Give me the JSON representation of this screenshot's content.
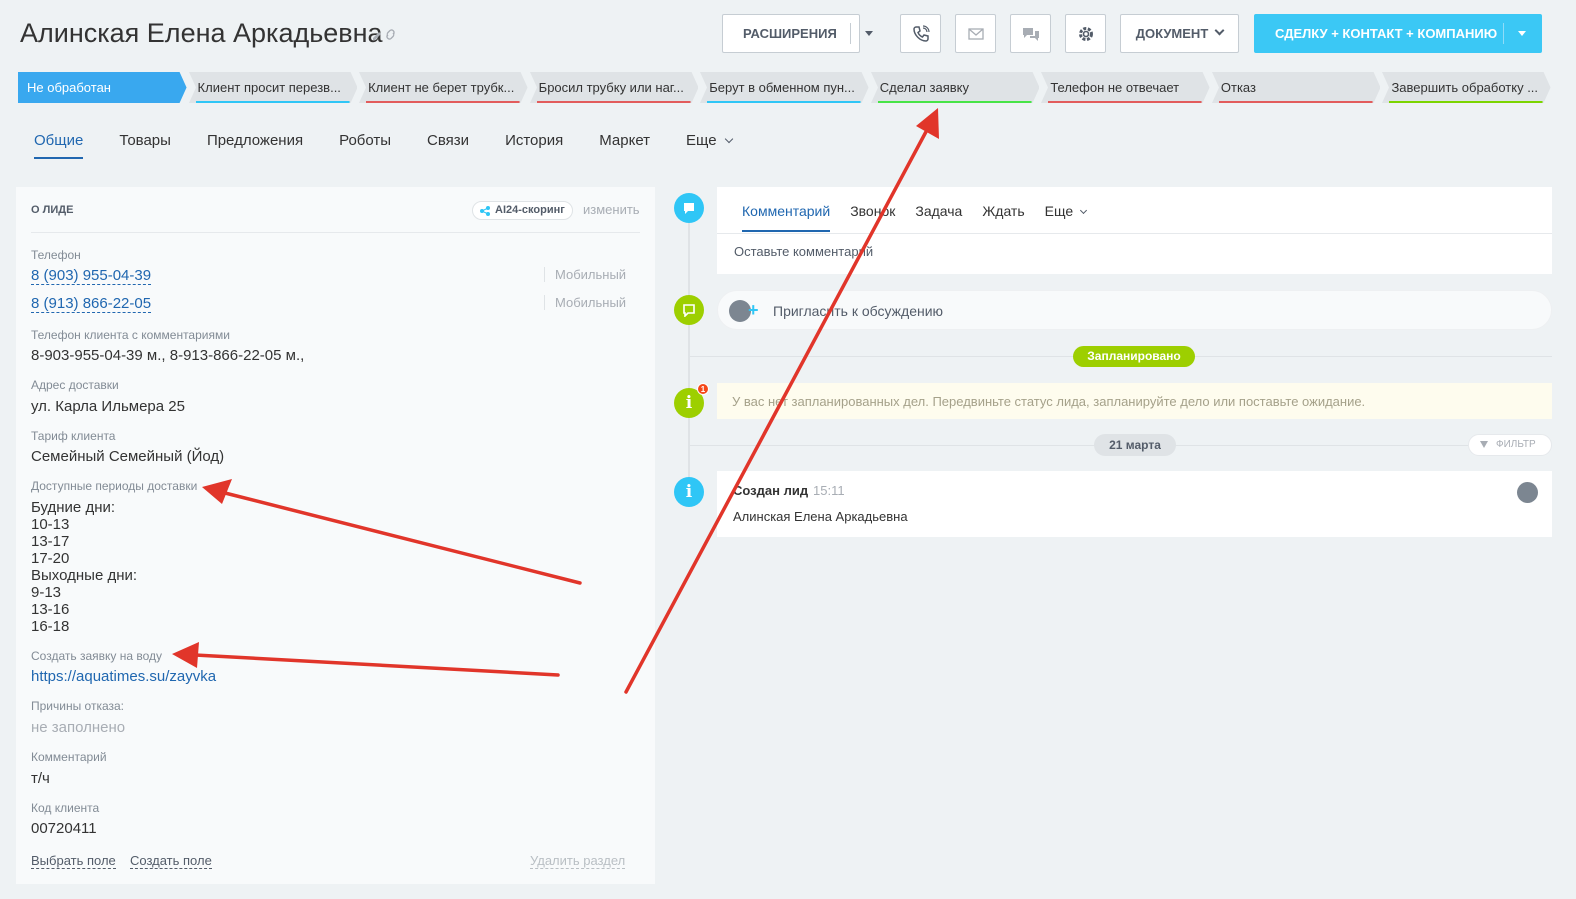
{
  "header": {
    "title": "Алинская Елена  Аркадьевна",
    "extensions_label": "РАСШИРЕНИЯ",
    "document_label": "ДОКУМЕНТ",
    "convert_label": "СДЕЛКУ + КОНТАКТ + КОМПАНИЮ"
  },
  "stages": [
    {
      "label": "Не обработан",
      "color": "#39a8ef",
      "active": true
    },
    {
      "label": "Клиент просит перезв...",
      "color": "#2fc6f6"
    },
    {
      "label": "Клиент не берет трубк...",
      "color": "#e25c5c"
    },
    {
      "label": "Бросил трубку или наг...",
      "color": "#e25c5c"
    },
    {
      "label": "Берут в обменном пун...",
      "color": "#2fc6f6"
    },
    {
      "label": "Сделал заявку",
      "color": "#47e447"
    },
    {
      "label": "Телефон не отвечает",
      "color": "#e25c5c"
    },
    {
      "label": "Отказ",
      "color": "#e25c5c"
    },
    {
      "label": "Завершить обработку ...",
      "color": "#7bd500"
    }
  ],
  "tabs": [
    "Общие",
    "Товары",
    "Предложения",
    "Роботы",
    "Связи",
    "История",
    "Маркет",
    "Еще"
  ],
  "about": {
    "heading": "О ЛИДЕ",
    "ai_badge": "AI24-скоринг",
    "change": "изменить",
    "phone_label": "Телефон",
    "phones": [
      {
        "number": "8 (903) 955-04-39",
        "type": "Мобильный"
      },
      {
        "number": "8 (913) 866-22-05",
        "type": "Мобильный"
      }
    ],
    "phone_comments_label": "Телефон клиента с комментариями",
    "phone_comments_value": "8-903-955-04-39 м., 8-913-866-22-05 м.,",
    "address_label": "Адрес доставки",
    "address_value": "ул. Карла Ильмера 25",
    "tariff_label": "Тариф клиента",
    "tariff_value": "Семейный Семейный (Йод)",
    "periods_label": "Доступные периоды доставки",
    "periods_value": "Будние дни:\n10-13\n13-17\n17-20\nВыходные дни:\n9-13\n13-16\n16-18",
    "order_label": "Создать заявку на воду",
    "order_value": "https://aquatimes.su/zayvka",
    "reasons_label": "Причины отказа:",
    "reasons_value": "не заполнено",
    "comment_label": "Комментарий",
    "comment_value": "т/ч",
    "code_label": "Код клиента",
    "code_value": "00720411",
    "select_field": "Выбрать поле",
    "create_field": "Создать поле",
    "delete_section": "Удалить раздел"
  },
  "timeline": {
    "comment_tabs": [
      "Комментарий",
      "Звонок",
      "Задача",
      "Ждать",
      "Еще"
    ],
    "comment_placeholder": "Оставьте комментарий",
    "invite": "Пригласить к обсуждению",
    "planned": "Запланировано",
    "notice_badge": "1",
    "notice": "У вас нет запланированных дел. Передвиньте статус лида, запланируйте дело или поставьте ожидание.",
    "date": "21 марта",
    "filter": "ФИЛЬТР",
    "event_title": "Создан лид",
    "event_time": "15:11",
    "event_name": "Алинская Елена Аркадьевна"
  },
  "colors": {
    "accent": "#2067b0",
    "primary_button": "#3bc8f5",
    "arrow": "#e1352a"
  }
}
